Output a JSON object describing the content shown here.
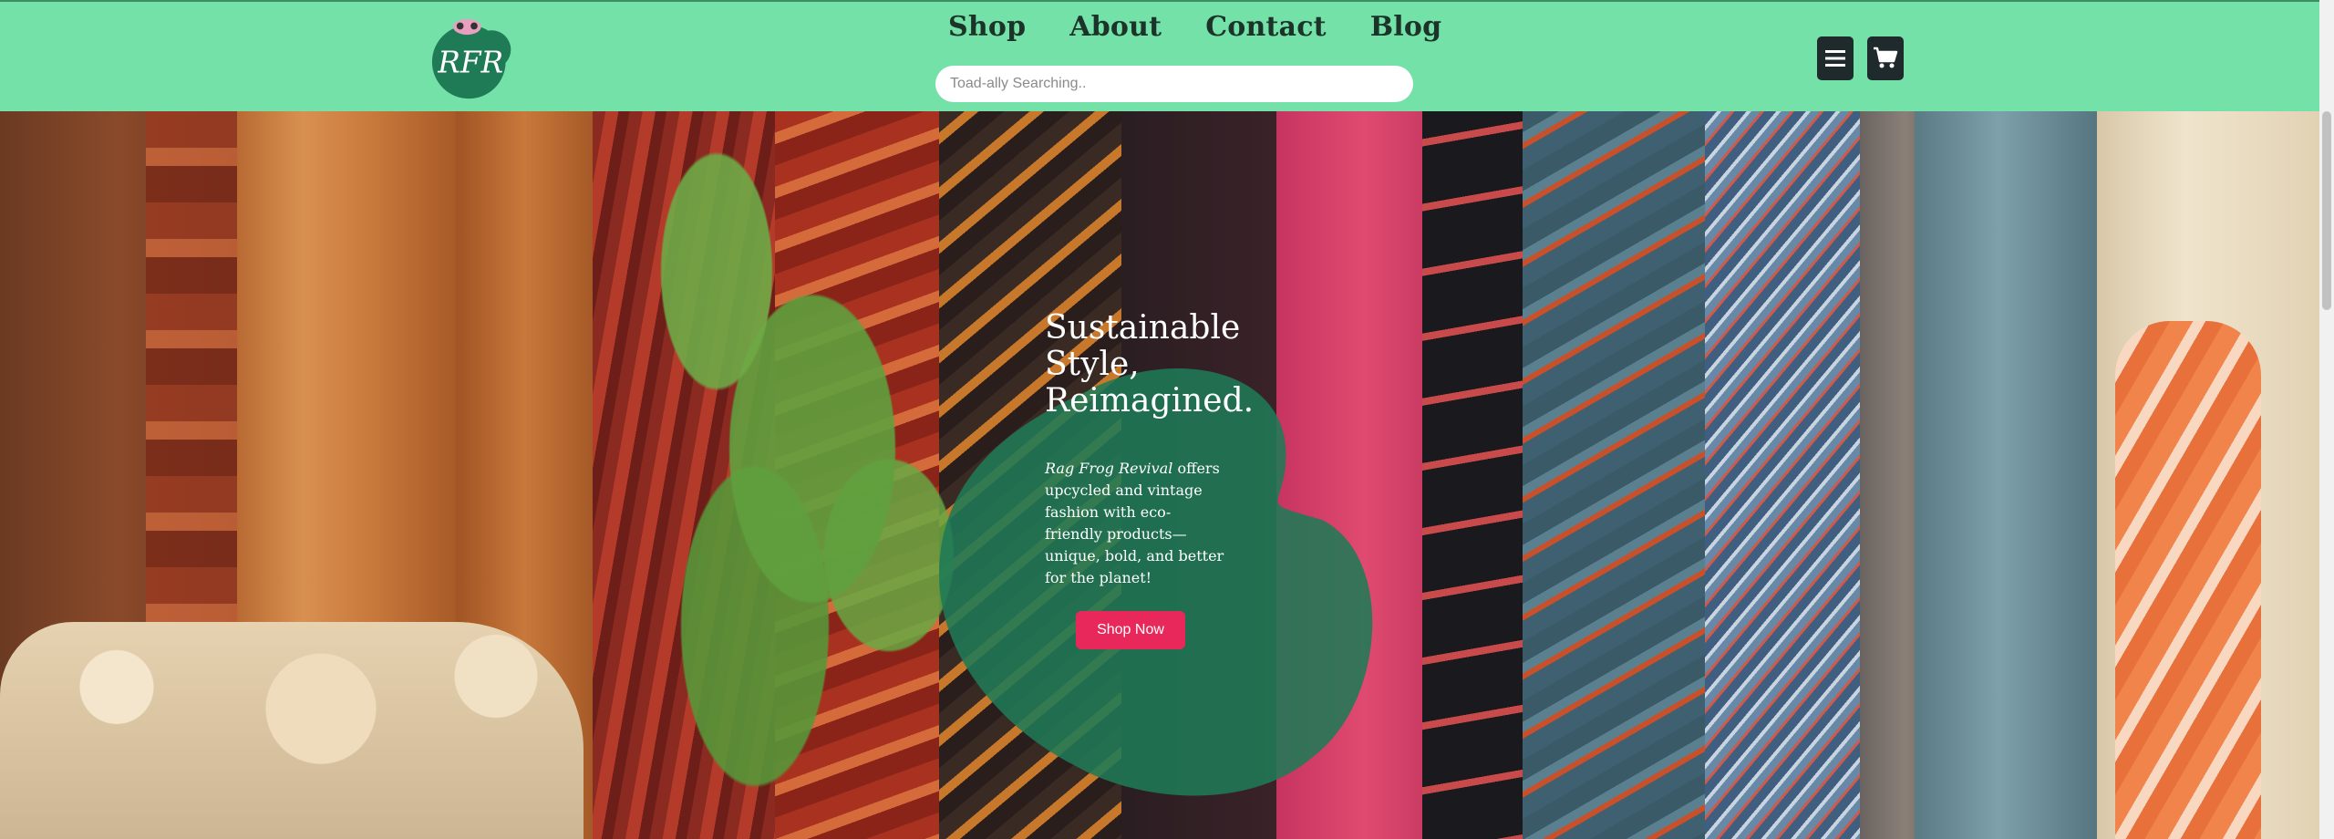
{
  "header": {
    "logo_text": "RFR",
    "nav": [
      {
        "label": "Shop"
      },
      {
        "label": "About"
      },
      {
        "label": "Contact"
      },
      {
        "label": "Blog"
      }
    ],
    "search": {
      "placeholder": "Toad-ally Searching..",
      "value": ""
    },
    "icons": [
      "menu-icon",
      "cart-icon"
    ]
  },
  "hero": {
    "title": "Sustainable Style, Reimagined.",
    "brand": "Rag Frog Revival",
    "description": " offers upcycled and vintage fashion with eco-friendly products—unique, bold, and better for the planet!",
    "cta_label": "Shop Now"
  },
  "colors": {
    "header_bg": "#74e1a8",
    "blob": "#1f7a56",
    "cta": "#e8285a",
    "icon_button": "#1f2a2c"
  }
}
